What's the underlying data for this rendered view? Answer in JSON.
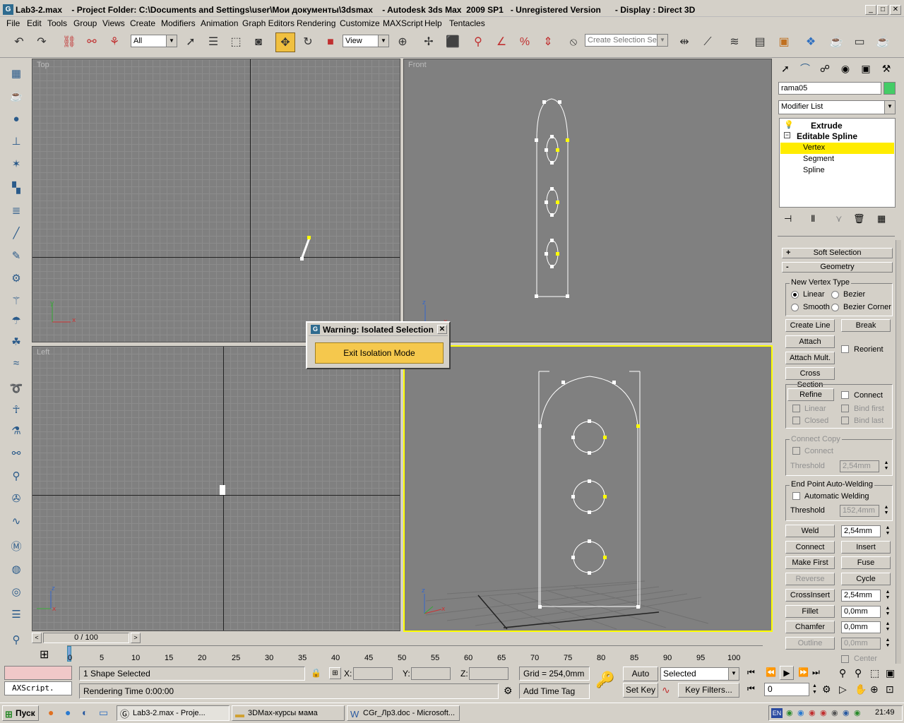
{
  "window": {
    "title": "Lab3-2.max    - Project Folder: C:\\Documents and Settings\\user\\Мои документы\\3dsmax    - Autodesk 3ds Max  2009 SP1   - Unregistered Version      - Display : Direct 3D"
  },
  "menu": [
    "File",
    "Edit",
    "Tools",
    "Group",
    "Views",
    "Create",
    "Modifiers",
    "Animation",
    "Graph Editors",
    "Rendering",
    "Customize",
    "MAXScript",
    "Help",
    "Tentacles"
  ],
  "toolbar": {
    "selection_filter": "All",
    "reference_coord": "View",
    "named_selection_placeholder": "Create Selection Set",
    "accent": "#f0c040"
  },
  "viewports": {
    "top": "Top",
    "front": "Front",
    "left": "Left",
    "active_border": "#ffff00"
  },
  "dialog": {
    "title": "Warning: Isolated Selection",
    "button": "Exit Isolation Mode"
  },
  "command_panel": {
    "object_name": "rama05",
    "object_color": "#44cc66",
    "modifier_list": "Modifier List",
    "stack": {
      "extrude": "Extrude",
      "editable_spline": "Editable Spline",
      "vertex": "Vertex",
      "segment": "Segment",
      "spline": "Spline"
    },
    "rollouts": {
      "soft_selection": "Soft Selection",
      "geometry": "Geometry"
    },
    "new_vertex_type": {
      "label": "New Vertex Type",
      "linear": "Linear",
      "bezier": "Bezier",
      "smooth": "Smooth",
      "bezier_corner": "Bezier Corner"
    },
    "buttons": {
      "create_line": "Create Line",
      "break": "Break",
      "attach": "Attach",
      "attach_mult": "Attach Mult.",
      "reorient": "Reorient",
      "cross_section": "Cross Section",
      "refine": "Refine",
      "connect": "Connect",
      "linear": "Linear",
      "bind_first": "Bind first",
      "closed": "Closed",
      "bind_last": "Bind last"
    },
    "connect_copy": {
      "label": "Connect Copy",
      "connect": "Connect",
      "threshold": "Threshold",
      "threshold_value": "2,54mm"
    },
    "end_point": {
      "label": "End Point Auto-Welding",
      "auto_weld": "Automatic Welding",
      "threshold": "Threshold",
      "threshold_value": "152,4mm"
    },
    "ops": {
      "weld": "Weld",
      "weld_value": "2,54mm",
      "connect": "Connect",
      "insert": "Insert",
      "make_first": "Make First",
      "fuse": "Fuse",
      "reverse": "Reverse",
      "cycle": "Cycle",
      "crossinsert": "CrossInsert",
      "crossinsert_value": "2,54mm",
      "fillet": "Fillet",
      "fillet_value": "0,0mm",
      "chamfer": "Chamfer",
      "chamfer_value": "0,0mm",
      "outline": "Outline",
      "outline_value": "0,0mm",
      "center": "Center"
    }
  },
  "timeline": {
    "frame_counter": "0 / 100",
    "ticks": [
      "0",
      "5",
      "10",
      "15",
      "20",
      "25",
      "30",
      "35",
      "40",
      "45",
      "50",
      "55",
      "60",
      "65",
      "70",
      "75",
      "80",
      "85",
      "90",
      "95",
      "100"
    ]
  },
  "status": {
    "maxscript": "AXScript.",
    "selection": "1 Shape Selected",
    "rendering_time": "Rendering Time  0:00:00",
    "x_label": "X:",
    "y_label": "Y:",
    "z_label": "Z:",
    "grid": "Grid = 254,0mm",
    "add_time_tag": "Add Time Tag",
    "auto_key": "Auto Key",
    "set_key": "Set Key",
    "key_mode": "Selected",
    "key_filters": "Key Filters...",
    "frame": "0"
  },
  "taskbar": {
    "start": "Пуск",
    "tasks": [
      "Lab3-2.max    - Proje...",
      "3DMax-курсы мама",
      "CGr_Лр3.doc - Microsoft..."
    ],
    "lang": "EN",
    "clock": "21:49"
  }
}
